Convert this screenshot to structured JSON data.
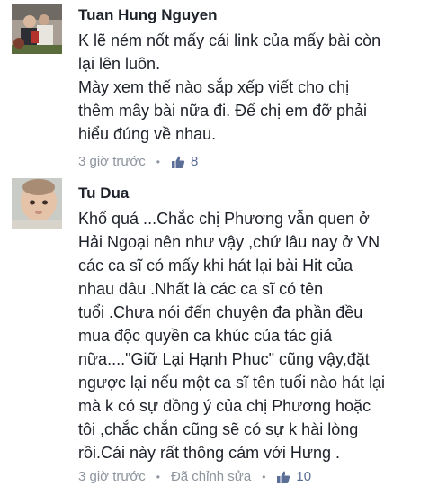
{
  "comments": [
    {
      "author": "Tuan Hung Nguyen",
      "text": "K lẽ ném nốt mấy cái link của mấy bài còn\nlại lên luôn.\nMày xem thế nào sắp xếp viết cho chị\nthêm mây bài nữa đi. Để chị em đỡ phải\nhiểu đúng về nhau.",
      "time": "3 giờ trước",
      "likes": "8",
      "like_icon": "thumbs-up-icon"
    },
    {
      "author": "Tu Dua",
      "text": "Khổ quá ...Chắc chị Phương vẫn quen ở\nHải Ngoại nên như vậy ,chứ lâu nay ở VN\ncác ca sĩ có mấy khi hát lại bài Hit của\nnhau đâu .Nhất là các ca sĩ có tên\ntuổi .Chưa nói đến chuyện đa phần đều\nmua độc quyền ca khúc của tác giả\nnữa....\"Giữ Lại Hạnh Phuc\" cũng vậy,đặt\nngược lại nếu một ca sĩ tên tuổi nào hát lại\nmà k có sự đồng ý của chị Phương hoặc\ntôi ,chắc chắn cũng sẽ có sự k hài lòng\nrồi.Cái này rất thông cảm với Hưng .",
      "time": "3 giờ trước",
      "edited": "Đã chỉnh sửa",
      "likes": "10",
      "like_icon": "thumbs-up-icon"
    }
  ],
  "colors": {
    "text": "#1d2129",
    "meta": "#8d949e",
    "like": "#5b6e96"
  }
}
